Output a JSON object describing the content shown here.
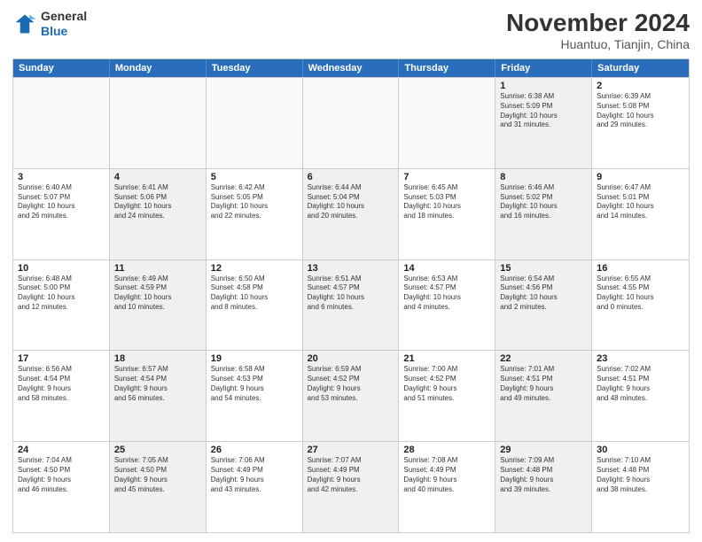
{
  "header": {
    "logo_line1": "General",
    "logo_line2": "Blue",
    "month": "November 2024",
    "location": "Huantuo, Tianjin, China"
  },
  "days_of_week": [
    "Sunday",
    "Monday",
    "Tuesday",
    "Wednesday",
    "Thursday",
    "Friday",
    "Saturday"
  ],
  "weeks": [
    [
      {
        "day": "",
        "info": "",
        "empty": true
      },
      {
        "day": "",
        "info": "",
        "empty": true
      },
      {
        "day": "",
        "info": "",
        "empty": true
      },
      {
        "day": "",
        "info": "",
        "empty": true
      },
      {
        "day": "",
        "info": "",
        "empty": true
      },
      {
        "day": "1",
        "info": "Sunrise: 6:38 AM\nSunset: 5:09 PM\nDaylight: 10 hours\nand 31 minutes.",
        "empty": false
      },
      {
        "day": "2",
        "info": "Sunrise: 6:39 AM\nSunset: 5:08 PM\nDaylight: 10 hours\nand 29 minutes.",
        "empty": false
      }
    ],
    [
      {
        "day": "3",
        "info": "Sunrise: 6:40 AM\nSunset: 5:07 PM\nDaylight: 10 hours\nand 26 minutes.",
        "empty": false
      },
      {
        "day": "4",
        "info": "Sunrise: 6:41 AM\nSunset: 5:06 PM\nDaylight: 10 hours\nand 24 minutes.",
        "empty": false
      },
      {
        "day": "5",
        "info": "Sunrise: 6:42 AM\nSunset: 5:05 PM\nDaylight: 10 hours\nand 22 minutes.",
        "empty": false
      },
      {
        "day": "6",
        "info": "Sunrise: 6:44 AM\nSunset: 5:04 PM\nDaylight: 10 hours\nand 20 minutes.",
        "empty": false
      },
      {
        "day": "7",
        "info": "Sunrise: 6:45 AM\nSunset: 5:03 PM\nDaylight: 10 hours\nand 18 minutes.",
        "empty": false
      },
      {
        "day": "8",
        "info": "Sunrise: 6:46 AM\nSunset: 5:02 PM\nDaylight: 10 hours\nand 16 minutes.",
        "empty": false
      },
      {
        "day": "9",
        "info": "Sunrise: 6:47 AM\nSunset: 5:01 PM\nDaylight: 10 hours\nand 14 minutes.",
        "empty": false
      }
    ],
    [
      {
        "day": "10",
        "info": "Sunrise: 6:48 AM\nSunset: 5:00 PM\nDaylight: 10 hours\nand 12 minutes.",
        "empty": false
      },
      {
        "day": "11",
        "info": "Sunrise: 6:49 AM\nSunset: 4:59 PM\nDaylight: 10 hours\nand 10 minutes.",
        "empty": false
      },
      {
        "day": "12",
        "info": "Sunrise: 6:50 AM\nSunset: 4:58 PM\nDaylight: 10 hours\nand 8 minutes.",
        "empty": false
      },
      {
        "day": "13",
        "info": "Sunrise: 6:51 AM\nSunset: 4:57 PM\nDaylight: 10 hours\nand 6 minutes.",
        "empty": false
      },
      {
        "day": "14",
        "info": "Sunrise: 6:53 AM\nSunset: 4:57 PM\nDaylight: 10 hours\nand 4 minutes.",
        "empty": false
      },
      {
        "day": "15",
        "info": "Sunrise: 6:54 AM\nSunset: 4:56 PM\nDaylight: 10 hours\nand 2 minutes.",
        "empty": false
      },
      {
        "day": "16",
        "info": "Sunrise: 6:55 AM\nSunset: 4:55 PM\nDaylight: 10 hours\nand 0 minutes.",
        "empty": false
      }
    ],
    [
      {
        "day": "17",
        "info": "Sunrise: 6:56 AM\nSunset: 4:54 PM\nDaylight: 9 hours\nand 58 minutes.",
        "empty": false
      },
      {
        "day": "18",
        "info": "Sunrise: 6:57 AM\nSunset: 4:54 PM\nDaylight: 9 hours\nand 56 minutes.",
        "empty": false
      },
      {
        "day": "19",
        "info": "Sunrise: 6:58 AM\nSunset: 4:53 PM\nDaylight: 9 hours\nand 54 minutes.",
        "empty": false
      },
      {
        "day": "20",
        "info": "Sunrise: 6:59 AM\nSunset: 4:52 PM\nDaylight: 9 hours\nand 53 minutes.",
        "empty": false
      },
      {
        "day": "21",
        "info": "Sunrise: 7:00 AM\nSunset: 4:52 PM\nDaylight: 9 hours\nand 51 minutes.",
        "empty": false
      },
      {
        "day": "22",
        "info": "Sunrise: 7:01 AM\nSunset: 4:51 PM\nDaylight: 9 hours\nand 49 minutes.",
        "empty": false
      },
      {
        "day": "23",
        "info": "Sunrise: 7:02 AM\nSunset: 4:51 PM\nDaylight: 9 hours\nand 48 minutes.",
        "empty": false
      }
    ],
    [
      {
        "day": "24",
        "info": "Sunrise: 7:04 AM\nSunset: 4:50 PM\nDaylight: 9 hours\nand 46 minutes.",
        "empty": false
      },
      {
        "day": "25",
        "info": "Sunrise: 7:05 AM\nSunset: 4:50 PM\nDaylight: 9 hours\nand 45 minutes.",
        "empty": false
      },
      {
        "day": "26",
        "info": "Sunrise: 7:06 AM\nSunset: 4:49 PM\nDaylight: 9 hours\nand 43 minutes.",
        "empty": false
      },
      {
        "day": "27",
        "info": "Sunrise: 7:07 AM\nSunset: 4:49 PM\nDaylight: 9 hours\nand 42 minutes.",
        "empty": false
      },
      {
        "day": "28",
        "info": "Sunrise: 7:08 AM\nSunset: 4:49 PM\nDaylight: 9 hours\nand 40 minutes.",
        "empty": false
      },
      {
        "day": "29",
        "info": "Sunrise: 7:09 AM\nSunset: 4:48 PM\nDaylight: 9 hours\nand 39 minutes.",
        "empty": false
      },
      {
        "day": "30",
        "info": "Sunrise: 7:10 AM\nSunset: 4:48 PM\nDaylight: 9 hours\nand 38 minutes.",
        "empty": false
      }
    ]
  ]
}
